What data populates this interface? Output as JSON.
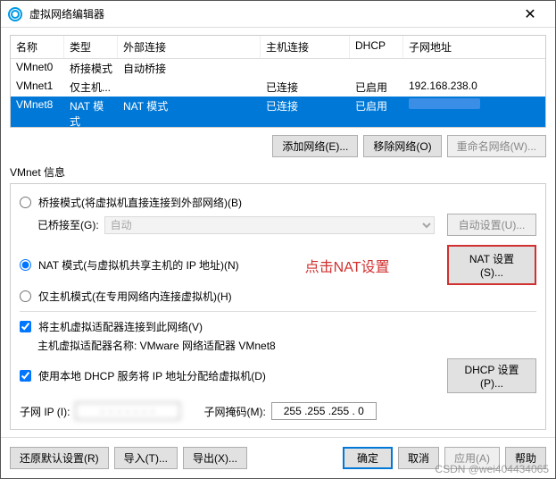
{
  "title": "虚拟网络编辑器",
  "columns": {
    "name": "名称",
    "type": "类型",
    "ext": "外部连接",
    "host": "主机连接",
    "dhcp": "DHCP",
    "subnet": "子网地址"
  },
  "rows": [
    {
      "name": "VMnet0",
      "type": "桥接模式",
      "ext": "自动桥接",
      "host": "",
      "dhcp": "",
      "subnet": ""
    },
    {
      "name": "VMnet1",
      "type": "仅主机...",
      "ext": "",
      "host": "已连接",
      "dhcp": "已启用",
      "subnet": "192.168.238.0"
    },
    {
      "name": "VMnet8",
      "type": "NAT 模式",
      "ext": "NAT 模式",
      "host": "已连接",
      "dhcp": "已启用",
      "subnet": ""
    }
  ],
  "table_btns": {
    "add": "添加网络(E)...",
    "remove": "移除网络(O)",
    "rename": "重命名网络(W)..."
  },
  "info_label": "VMnet 信息",
  "radios": {
    "bridge": "桥接模式(将虚拟机直接连接到外部网络)(B)",
    "bridge_to_label": "已桥接至(G):",
    "bridge_to_value": "自动",
    "bridge_auto_btn": "自动设置(U)...",
    "nat": "NAT 模式(与虚拟机共享主机的 IP 地址)(N)",
    "nat_btn": "NAT 设置(S)...",
    "hostonly": "仅主机模式(在专用网络内连接虚拟机)(H)"
  },
  "annotation": "点击NAT设置",
  "checks": {
    "connect_host": "将主机虚拟适配器连接到此网络(V)",
    "adapter_label": "主机虚拟适配器名称: VMware 网络适配器 VMnet8",
    "use_dhcp": "使用本地 DHCP 服务将 IP 地址分配给虚拟机(D)",
    "dhcp_btn": "DHCP 设置(P)..."
  },
  "subnet": {
    "ip_label": "子网 IP (I):",
    "ip_value": "· · · · · · ·",
    "mask_label": "子网掩码(M):",
    "mask_value": "255 .255 .255 . 0"
  },
  "footer": {
    "restore": "还原默认设置(R)",
    "import": "导入(T)...",
    "export": "导出(X)...",
    "ok": "确定",
    "cancel": "取消",
    "apply": "应用(A)",
    "help": "帮助"
  },
  "watermark": "CSDN @wei404434065"
}
